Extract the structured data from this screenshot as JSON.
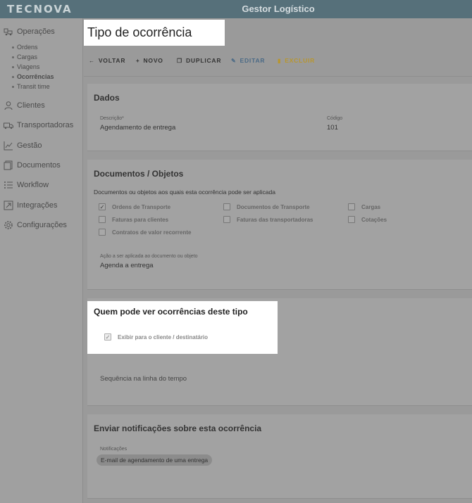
{
  "header": {
    "logo": "TECNOVA",
    "app_title": "Gestor Logístico"
  },
  "sidebar": {
    "operations": {
      "label": "Operações",
      "icon": "truck-boxes-icon",
      "children": [
        "Ordens",
        "Cargas",
        "Viagens",
        "Ocorrências",
        "Transit time"
      ],
      "active_child": "Ocorrências"
    },
    "items": [
      {
        "label": "Clientes",
        "icon": "person-icon"
      },
      {
        "label": "Transportadoras",
        "icon": "truck-icon"
      },
      {
        "label": "Gestão",
        "icon": "chart-line-icon"
      },
      {
        "label": "Documentos",
        "icon": "documents-icon"
      },
      {
        "label": "Workflow",
        "icon": "list-icon"
      },
      {
        "label": "Integrações",
        "icon": "integration-icon"
      },
      {
        "label": "Configurações",
        "icon": "gear-icon"
      }
    ]
  },
  "page": {
    "title": "Tipo de ocorrência"
  },
  "toolbar": {
    "back": "VOLTAR",
    "new": "NOVO",
    "duplicate": "DUPLICAR",
    "edit": "EDITAR",
    "delete": "EXCLUIR",
    "edit_color": "#4a6a86",
    "delete_color": "#b8962e"
  },
  "dados": {
    "title": "Dados",
    "descricao_label": "Descrição*",
    "descricao_value": "Agendamento de entrega",
    "codigo_label": "Código",
    "codigo_value": "101"
  },
  "documentos": {
    "title": "Documentos / Objetos",
    "subtitle": "Documentos ou objetos aos quais esta ocorrência pode ser aplicada",
    "options": [
      {
        "label": "Ordens de Transporte",
        "checked": true
      },
      {
        "label": "Documentos de Transporte",
        "checked": false
      },
      {
        "label": "Cargas",
        "checked": false
      },
      {
        "label": "Faturas para clientes",
        "checked": false
      },
      {
        "label": "Faturas das transportadoras",
        "checked": false
      },
      {
        "label": "Cotações",
        "checked": false
      },
      {
        "label": "Contratos de valor recorrente",
        "checked": false
      }
    ],
    "acao_label": "Ação a ser aplicada ao documento ou objeto",
    "acao_value": "Agenda a entrega"
  },
  "visibilidade": {
    "title": "Quem pode ver ocorrências deste tipo",
    "option_label": "Exibir para o cliente / destinatário",
    "option_checked": true,
    "sequencia_label": "Sequência na linha do tempo"
  },
  "notificacoes": {
    "title": "Enviar notificações sobre esta ocorrência",
    "field_label": "Notificações",
    "chip": "E-mail de agendamento de uma entrega"
  }
}
